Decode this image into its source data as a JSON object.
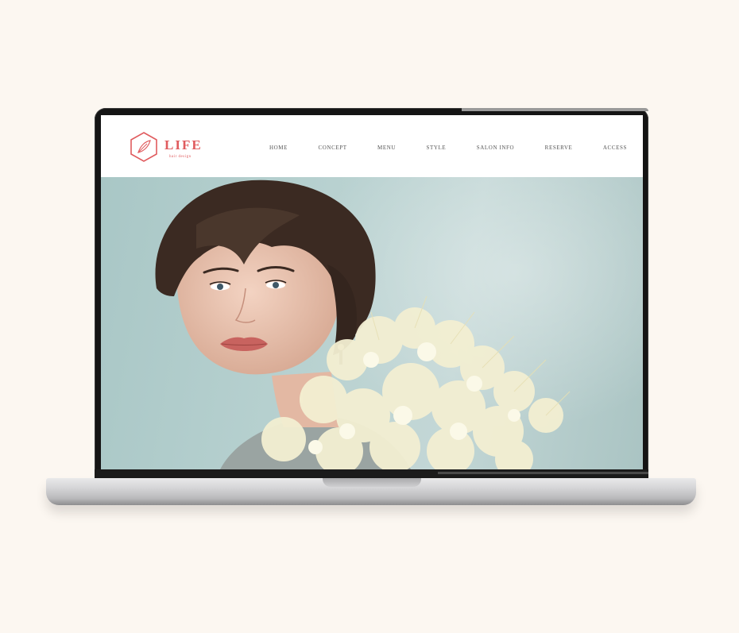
{
  "site": {
    "logo_text": "LIFE",
    "logo_subtext": "hair design",
    "nav": [
      "HOME",
      "CONCEPT",
      "MENU",
      "STYLE",
      "SALON INFO",
      "RESERVE",
      "ACCESS"
    ]
  },
  "hero": {
    "image": "woman-with-short-hair-and-babys-breath-flowers"
  },
  "colors": {
    "accent": "#e05b5e",
    "background": "#fcf7f1",
    "hero": "#b6d0cf"
  }
}
